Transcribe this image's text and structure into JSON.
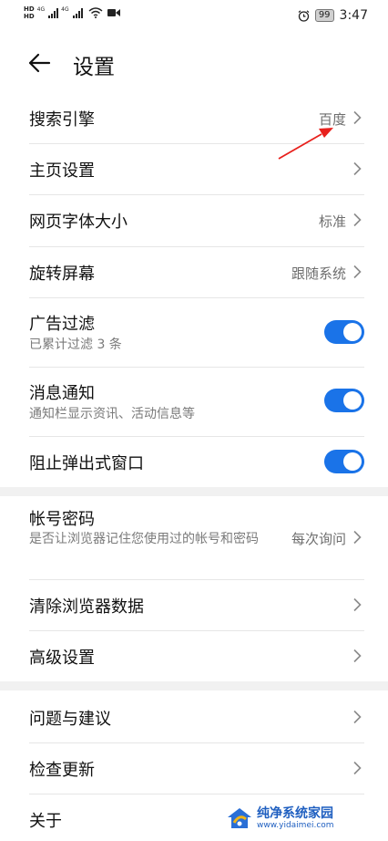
{
  "status_bar": {
    "hd_top": "HD",
    "hd_bottom": "HD",
    "net_tag_1": "4G",
    "net_tag_2": "4G",
    "battery": "99",
    "time": "3:47"
  },
  "header": {
    "title": "设置"
  },
  "settings": {
    "search_engine": {
      "title": "搜索引擎",
      "value": "百度"
    },
    "homepage": {
      "title": "主页设置"
    },
    "font_size": {
      "title": "网页字体大小",
      "value": "标准"
    },
    "rotate_screen": {
      "title": "旋转屏幕",
      "value": "跟随系统"
    },
    "ad_filter": {
      "title": "广告过滤",
      "subtitle": "已累计过滤 3 条",
      "enabled": true
    },
    "notifications": {
      "title": "消息通知",
      "subtitle": "通知栏显示资讯、活动信息等",
      "enabled": true
    },
    "block_popups": {
      "title": "阻止弹出式窗口",
      "enabled": true
    },
    "passwords": {
      "title": "帐号密码",
      "subtitle": "是否让浏览器记住您使用过的帐号和密码",
      "value": "每次询问"
    },
    "clear_data": {
      "title": "清除浏览器数据"
    },
    "advanced": {
      "title": "高级设置"
    },
    "feedback": {
      "title": "问题与建议"
    },
    "check_update": {
      "title": "检查更新"
    },
    "about": {
      "title": "关于"
    }
  },
  "watermark": {
    "text": "纯净系统家园",
    "url": "www.yidaimei.com"
  },
  "colors": {
    "toggle_on": "#1a73e8",
    "annotation_arrow": "#e8201c"
  }
}
